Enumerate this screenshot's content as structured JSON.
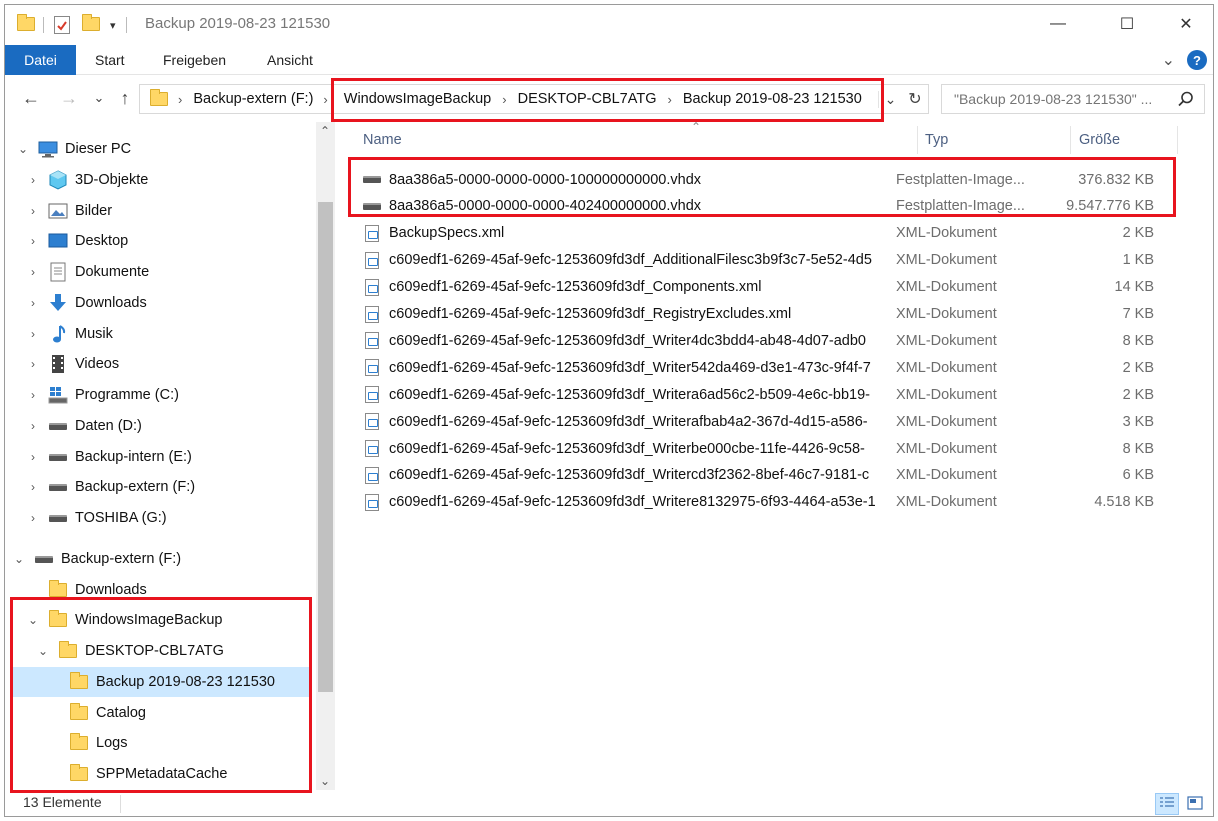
{
  "window": {
    "title": "Backup 2019-08-23 121530",
    "minimize_glyph": "—",
    "maximize_glyph": "☐",
    "close_glyph": "✕"
  },
  "ribbon": {
    "tabs": [
      "Datei",
      "Start",
      "Freigeben",
      "Ansicht"
    ],
    "expand_glyph": "⌄",
    "help_glyph": "?"
  },
  "navigation": {
    "back_glyph": "←",
    "forward_glyph": "→",
    "recent_glyph": "⌄",
    "up_glyph": "↑",
    "breadcrumbs": [
      "Backup-extern (F:)",
      "WindowsImageBackup",
      "DESKTOP-CBL7ATG",
      "Backup 2019-08-23 121530"
    ],
    "separator_glyph": "›",
    "dropdown_glyph": "⌄",
    "refresh_glyph": "↻",
    "search_placeholder": "\"Backup 2019-08-23 121530\" ...",
    "search_icon": "search-icon"
  },
  "nav_pane": {
    "items": [
      {
        "label": "Dieser PC",
        "icon": "computer-icon",
        "chevron": "⌄"
      },
      {
        "label": "3D-Objekte",
        "icon": "3d-objects-icon",
        "chevron": "›"
      },
      {
        "label": "Bilder",
        "icon": "pictures-icon",
        "chevron": "›"
      },
      {
        "label": "Desktop",
        "icon": "desktop-icon",
        "chevron": "›"
      },
      {
        "label": "Dokumente",
        "icon": "documents-icon",
        "chevron": "›"
      },
      {
        "label": "Downloads",
        "icon": "downloads-icon",
        "chevron": "›"
      },
      {
        "label": "Musik",
        "icon": "music-icon",
        "chevron": "›"
      },
      {
        "label": "Videos",
        "icon": "videos-icon",
        "chevron": "›"
      },
      {
        "label": "Programme (C:)",
        "icon": "windows-drive-icon",
        "chevron": "›"
      },
      {
        "label": "Daten (D:)",
        "icon": "drive-icon",
        "chevron": "›"
      },
      {
        "label": "Backup-intern (E:)",
        "icon": "drive-icon",
        "chevron": "›"
      },
      {
        "label": "Backup-extern (F:)",
        "icon": "drive-icon",
        "chevron": "›"
      },
      {
        "label": "TOSHIBA (G:)",
        "icon": "drive-icon",
        "chevron": "›"
      },
      {
        "label": "Backup-extern (F:)",
        "icon": "drive-icon",
        "chevron": "⌄"
      },
      {
        "label": "Downloads",
        "icon": "folder-icon",
        "chevron": ""
      },
      {
        "label": "WindowsImageBackup",
        "icon": "folder-icon",
        "chevron": "⌄"
      },
      {
        "label": "DESKTOP-CBL7ATG",
        "icon": "folder-icon",
        "chevron": "⌄"
      },
      {
        "label": "Backup 2019-08-23 121530",
        "icon": "folder-icon",
        "chevron": ""
      },
      {
        "label": "Catalog",
        "icon": "folder-icon",
        "chevron": ""
      },
      {
        "label": "Logs",
        "icon": "folder-icon",
        "chevron": ""
      },
      {
        "label": "SPPMetadataCache",
        "icon": "folder-icon",
        "chevron": ""
      }
    ],
    "scroll_up_glyph": "⌃",
    "scroll_down_glyph": "⌄"
  },
  "file_list": {
    "columns": [
      "Name",
      "Typ",
      "Größe"
    ],
    "sort_indicator": "⌃",
    "rows": [
      {
        "name": "8aa386a5-0000-0000-0000-100000000000.vhdx",
        "type": "Festplatten-Image...",
        "size": "376.832 KB",
        "icon": "disk-image-icon"
      },
      {
        "name": "8aa386a5-0000-0000-0000-402400000000.vhdx",
        "type": "Festplatten-Image...",
        "size": "9.547.776 KB",
        "icon": "disk-image-icon"
      },
      {
        "name": "BackupSpecs.xml",
        "type": "XML-Dokument",
        "size": "2 KB",
        "icon": "xml-file-icon"
      },
      {
        "name": "c609edf1-6269-45af-9efc-1253609fd3df_AdditionalFilesc3b9f3c7-5e52-4d5",
        "type": "XML-Dokument",
        "size": "1 KB",
        "icon": "xml-file-icon"
      },
      {
        "name": "c609edf1-6269-45af-9efc-1253609fd3df_Components.xml",
        "type": "XML-Dokument",
        "size": "14 KB",
        "icon": "xml-file-icon"
      },
      {
        "name": "c609edf1-6269-45af-9efc-1253609fd3df_RegistryExcludes.xml",
        "type": "XML-Dokument",
        "size": "7 KB",
        "icon": "xml-file-icon"
      },
      {
        "name": "c609edf1-6269-45af-9efc-1253609fd3df_Writer4dc3bdd4-ab48-4d07-adb0",
        "type": "XML-Dokument",
        "size": "8 KB",
        "icon": "xml-file-icon"
      },
      {
        "name": "c609edf1-6269-45af-9efc-1253609fd3df_Writer542da469-d3e1-473c-9f4f-7",
        "type": "XML-Dokument",
        "size": "2 KB",
        "icon": "xml-file-icon"
      },
      {
        "name": "c609edf1-6269-45af-9efc-1253609fd3df_Writera6ad56c2-b509-4e6c-bb19-",
        "type": "XML-Dokument",
        "size": "2 KB",
        "icon": "xml-file-icon"
      },
      {
        "name": "c609edf1-6269-45af-9efc-1253609fd3df_Writerafbab4a2-367d-4d15-a586-",
        "type": "XML-Dokument",
        "size": "3 KB",
        "icon": "xml-file-icon"
      },
      {
        "name": "c609edf1-6269-45af-9efc-1253609fd3df_Writerbe000cbe-11fe-4426-9c58-",
        "type": "XML-Dokument",
        "size": "8 KB",
        "icon": "xml-file-icon"
      },
      {
        "name": "c609edf1-6269-45af-9efc-1253609fd3df_Writercd3f2362-8bef-46c7-9181-c",
        "type": "XML-Dokument",
        "size": "6 KB",
        "icon": "xml-file-icon"
      },
      {
        "name": "c609edf1-6269-45af-9efc-1253609fd3df_Writere8132975-6f93-4464-a53e-1",
        "type": "XML-Dokument",
        "size": "4.518 KB",
        "icon": "xml-file-icon"
      }
    ]
  },
  "status_bar": {
    "count": "13 Elemente"
  },
  "colors": {
    "accent": "#1a6bc1",
    "selection": "#cce8ff",
    "highlight_box": "#e8141e",
    "folder": "#ffd766"
  }
}
